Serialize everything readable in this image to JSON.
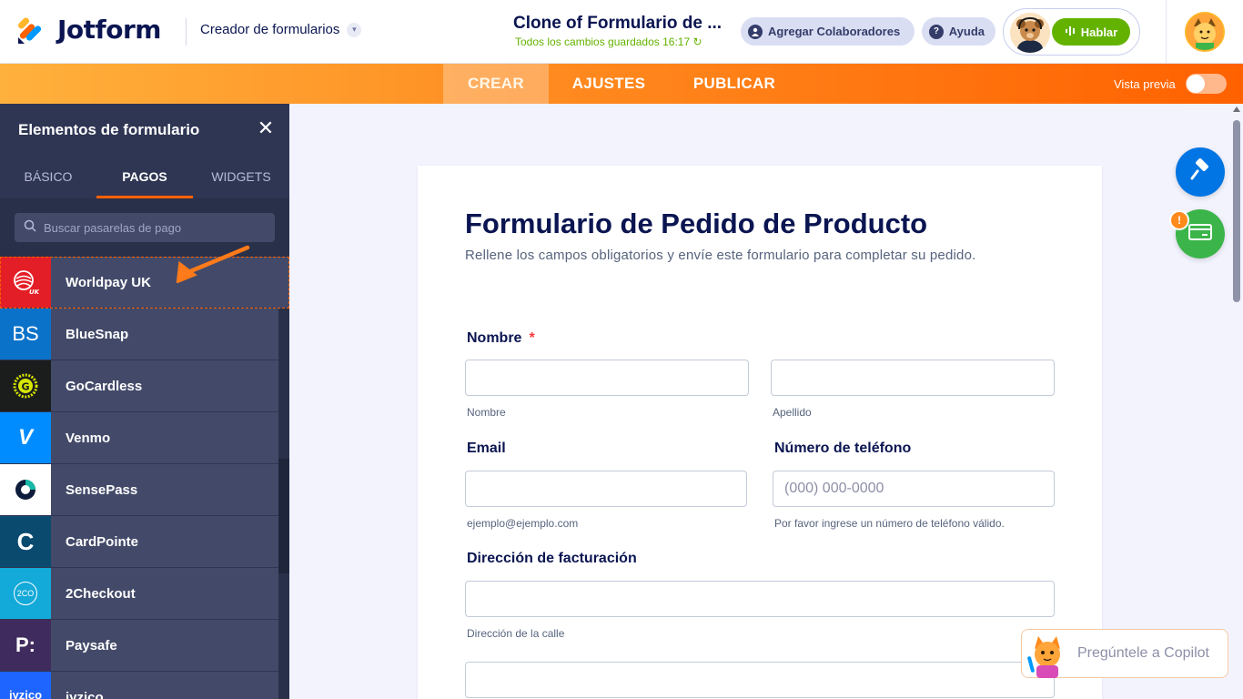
{
  "app": {
    "logo_text": "Jotform",
    "builder_label": "Creador de formularios",
    "form_title": "Clone of Formulario de ...",
    "save_status": "Todos los cambios guardados 16:17",
    "collab_label": "Agregar Colaboradores",
    "help_label": "Ayuda",
    "talk_label": "Hablar"
  },
  "nav": {
    "tabs": [
      {
        "label": "CREAR",
        "active": true
      },
      {
        "label": "AJUSTES",
        "active": false
      },
      {
        "label": "PUBLICAR",
        "active": false
      }
    ],
    "preview_label": "Vista previa"
  },
  "sidebar": {
    "title": "Elementos de formulario",
    "tabs": [
      {
        "label": "BÁSICO"
      },
      {
        "label": "PAGOS"
      },
      {
        "label": "WIDGETS"
      }
    ],
    "search_placeholder": "Buscar pasarelas de pago",
    "items": [
      {
        "label": "Worldpay UK",
        "icon": "worldpay-icon",
        "color": "#e41e26"
      },
      {
        "label": "BlueSnap",
        "icon": "bluesnap-icon",
        "icon_text": "BS",
        "color": "#0a72c9"
      },
      {
        "label": "GoCardless",
        "icon": "gocardless-icon",
        "icon_text": "G",
        "color": "#1b1d1d"
      },
      {
        "label": "Venmo",
        "icon": "venmo-icon",
        "icon_text": "V",
        "color": "#008cff"
      },
      {
        "label": "SensePass",
        "icon": "sensepass-icon",
        "color": "#ffffff"
      },
      {
        "label": "CardPointe",
        "icon": "cardpointe-icon",
        "icon_text": "C",
        "color": "#0b4a6f"
      },
      {
        "label": "2Checkout",
        "icon": "2checkout-icon",
        "icon_text": "2CO",
        "color": "#13a9d8"
      },
      {
        "label": "Paysafe",
        "icon": "paysafe-icon",
        "icon_text": "P:",
        "color": "#402b5f"
      },
      {
        "label": "iyzico",
        "icon": "iyzico-icon",
        "icon_text": "iyzico",
        "color": "#1e64ff"
      }
    ]
  },
  "form": {
    "heading": "Formulario de Pedido de Producto",
    "subheading": "Rellene los campos obligatorios y envíe este formulario para completar su pedido.",
    "name_label": "Nombre",
    "required_mark": "*",
    "first_name_hint": "Nombre",
    "last_name_hint": "Apellido",
    "email_label": "Email",
    "email_hint": "ejemplo@ejemplo.com",
    "phone_label": "Número de teléfono",
    "phone_placeholder": "(000) 000-0000",
    "phone_hint": "Por favor ingrese un número de teléfono válido.",
    "address_label": "Dirección de facturación",
    "street_hint": "Dirección de la calle"
  },
  "floating": {
    "badge": "!",
    "copilot_label": "Pregúntele a Copilot"
  },
  "colors": {
    "brand_orange": "#ff6100",
    "sidebar_bg": "#293049",
    "accent_green": "#64b200",
    "accent_blue": "#0075e3"
  }
}
